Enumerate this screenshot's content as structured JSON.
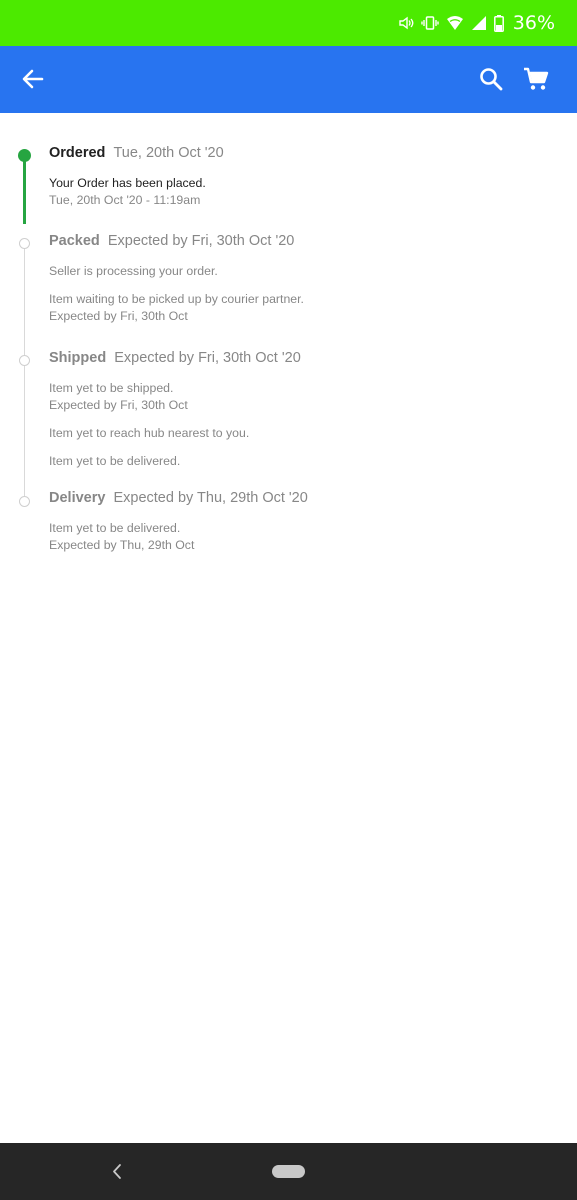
{
  "status_bar": {
    "battery_percent": "36%"
  },
  "colors": {
    "status_bar": "#4cea00",
    "app_bar": "#2874f0",
    "accent_green": "#26a541",
    "nav_bar": "#262626"
  },
  "app_bar": {
    "icons": [
      "back-arrow-icon",
      "search-icon",
      "cart-icon"
    ]
  },
  "steps": [
    {
      "name": "Ordered",
      "date": "Tue, 20th Oct '20",
      "done": true,
      "events": [
        {
          "text": "Your Order has been placed.",
          "date": "Tue, 20th Oct '20 - 11:19am"
        }
      ]
    },
    {
      "name": "Packed",
      "date": "Expected by Fri, 30th Oct '20",
      "done": false,
      "events": [
        {
          "text": "Seller is processing your order."
        },
        {
          "text": "Item waiting to be picked up by courier partner.",
          "date": "Expected by Fri, 30th Oct"
        }
      ]
    },
    {
      "name": "Shipped",
      "date": "Expected by Fri, 30th Oct '20",
      "done": false,
      "events": [
        {
          "text": "Item yet to be shipped.",
          "date": "Expected by Fri, 30th Oct"
        },
        {
          "text": "Item yet to reach hub nearest to you."
        },
        {
          "text": "Item yet to be delivered."
        }
      ]
    },
    {
      "name": "Delivery",
      "date": "Expected by Thu, 29th Oct '20",
      "done": false,
      "events": [
        {
          "text": "Item yet to be delivered.",
          "date": "Expected by Thu, 29th Oct"
        }
      ]
    }
  ]
}
